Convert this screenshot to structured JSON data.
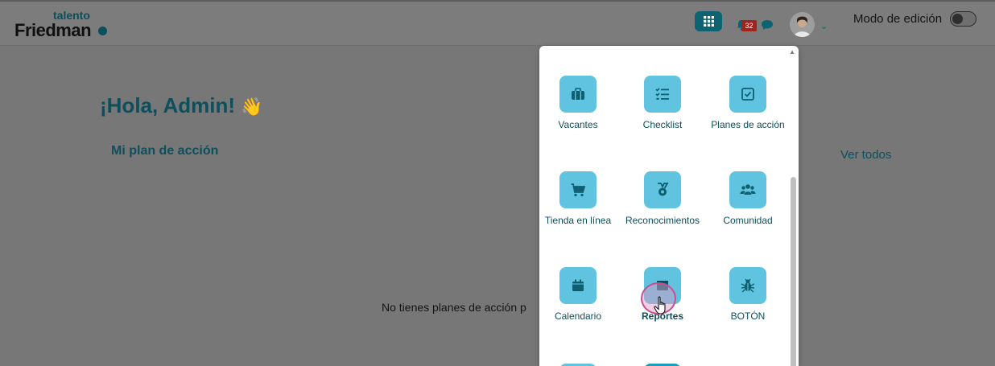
{
  "header": {
    "logo_top": "talento",
    "logo_main": "Friedman",
    "notification_count": "32",
    "mode_label": "Modo de edición"
  },
  "main": {
    "greeting": "¡Hola, Admin!",
    "greeting_emoji": "👋",
    "plan_title": "Mi plan de acción",
    "see_all": "Ver todos",
    "empty_message": "No tienes planes de acción p"
  },
  "apps_menu": {
    "items": [
      {
        "label": "Vacantes",
        "icon": "briefcase-icon"
      },
      {
        "label": "Checklist",
        "icon": "checklist-icon"
      },
      {
        "label": "Planes de acción",
        "icon": "checkbox-icon"
      },
      {
        "label": "Tienda en línea",
        "icon": "cart-icon"
      },
      {
        "label": "Reconocimientos",
        "icon": "medal-icon"
      },
      {
        "label": "Comunidad",
        "icon": "users-icon"
      },
      {
        "label": "Calendario",
        "icon": "calendar-icon"
      },
      {
        "label": "Reportes",
        "icon": "report-icon"
      },
      {
        "label": "BOTÓN",
        "icon": "bug-icon"
      }
    ]
  },
  "colors": {
    "brand": "#0d4f5c",
    "tile": "#60c3df",
    "apps_button": "#0e6373",
    "badge": "#a3221e"
  }
}
